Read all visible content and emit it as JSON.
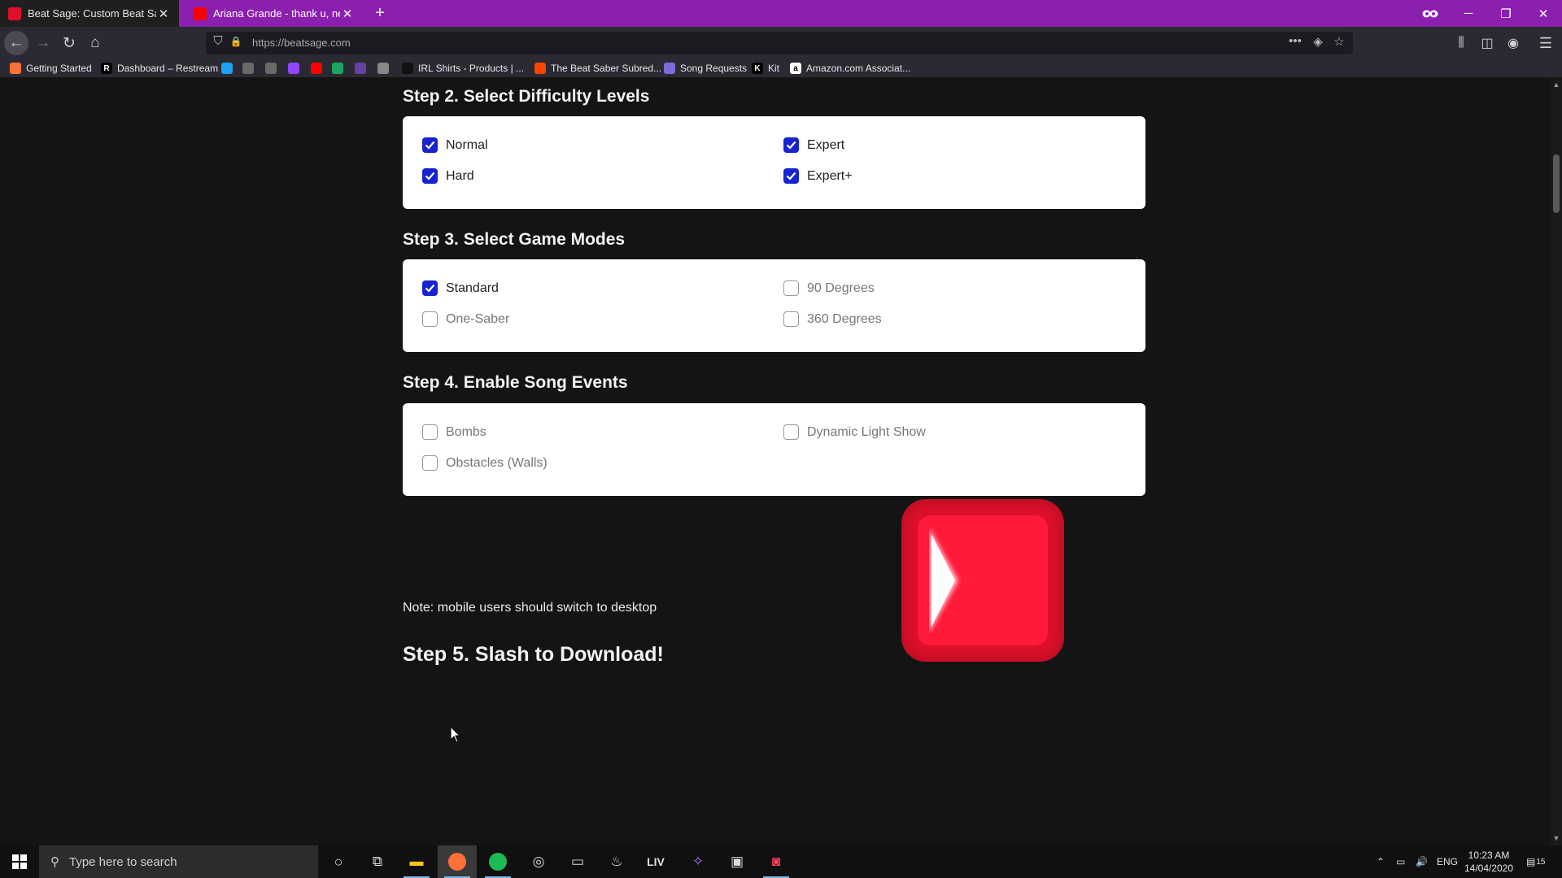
{
  "browser": {
    "tabs": [
      {
        "title": "Beat Sage: Custom Beat Saber Levels",
        "favicon_color": "#e0102b",
        "active": true
      },
      {
        "title": "Ariana Grande - thank u, next",
        "favicon_color": "#ff0000",
        "active": false
      }
    ],
    "new_tab_icon": "plus-icon",
    "url": "https://beatsage.com",
    "bookmarks": [
      {
        "label": "Getting Started",
        "icon_color": "#ff7139"
      },
      {
        "label": "Dashboard – Restream",
        "icon_color": "#000000",
        "glyph": "R"
      },
      {
        "label": "",
        "icon_color": "#1da1f2"
      },
      {
        "label": "",
        "icon_color": "#6a6a6a"
      },
      {
        "label": "",
        "icon_color": "#6a6a6a"
      },
      {
        "label": "",
        "icon_color": "#9146ff"
      },
      {
        "label": "",
        "icon_color": "#ff0000"
      },
      {
        "label": "",
        "icon_color": "#1fa463"
      },
      {
        "label": "",
        "icon_color": "#6441a5"
      },
      {
        "label": "",
        "icon_color": "#888888"
      },
      {
        "label": "IRL Shirts - Products | ...",
        "icon_color": "#111111"
      },
      {
        "label": "The Beat Saber Subred...",
        "icon_color": "#ff4500"
      },
      {
        "label": "Song Requests",
        "icon_color": "#7c6cd9"
      },
      {
        "label": "Kit",
        "icon_color": "#000000",
        "glyph": "K"
      },
      {
        "label": "Amazon.com Associat...",
        "icon_color": "#ffffff",
        "glyph": "a"
      }
    ]
  },
  "page": {
    "step2": {
      "title": "Step 2. Select Difficulty Levels",
      "options": [
        {
          "label": "Normal",
          "checked": true
        },
        {
          "label": "Expert",
          "checked": true
        },
        {
          "label": "Hard",
          "checked": true
        },
        {
          "label": "Expert+",
          "checked": true
        }
      ]
    },
    "step3": {
      "title": "Step 3. Select Game Modes",
      "options": [
        {
          "label": "Standard",
          "checked": true
        },
        {
          "label": "90 Degrees",
          "checked": false
        },
        {
          "label": "One-Saber",
          "checked": false
        },
        {
          "label": "360 Degrees",
          "checked": false
        }
      ]
    },
    "step4": {
      "title": "Step 4. Enable Song Events",
      "options": [
        {
          "label": "Bombs",
          "checked": false
        },
        {
          "label": "Dynamic Light Show",
          "checked": false
        },
        {
          "label": "Obstacles (Walls)",
          "checked": false
        }
      ]
    },
    "step5": {
      "title": "Step 5. Slash to Download!",
      "note": "Note: mobile users should switch to desktop"
    },
    "accent_color": "#1722d0",
    "slash_color": "#ff1a3a"
  },
  "taskbar": {
    "search_placeholder": "Type here to search",
    "language": "ENG",
    "time": "10:23 AM",
    "date": "14/04/2020",
    "notifications_count": "15"
  }
}
